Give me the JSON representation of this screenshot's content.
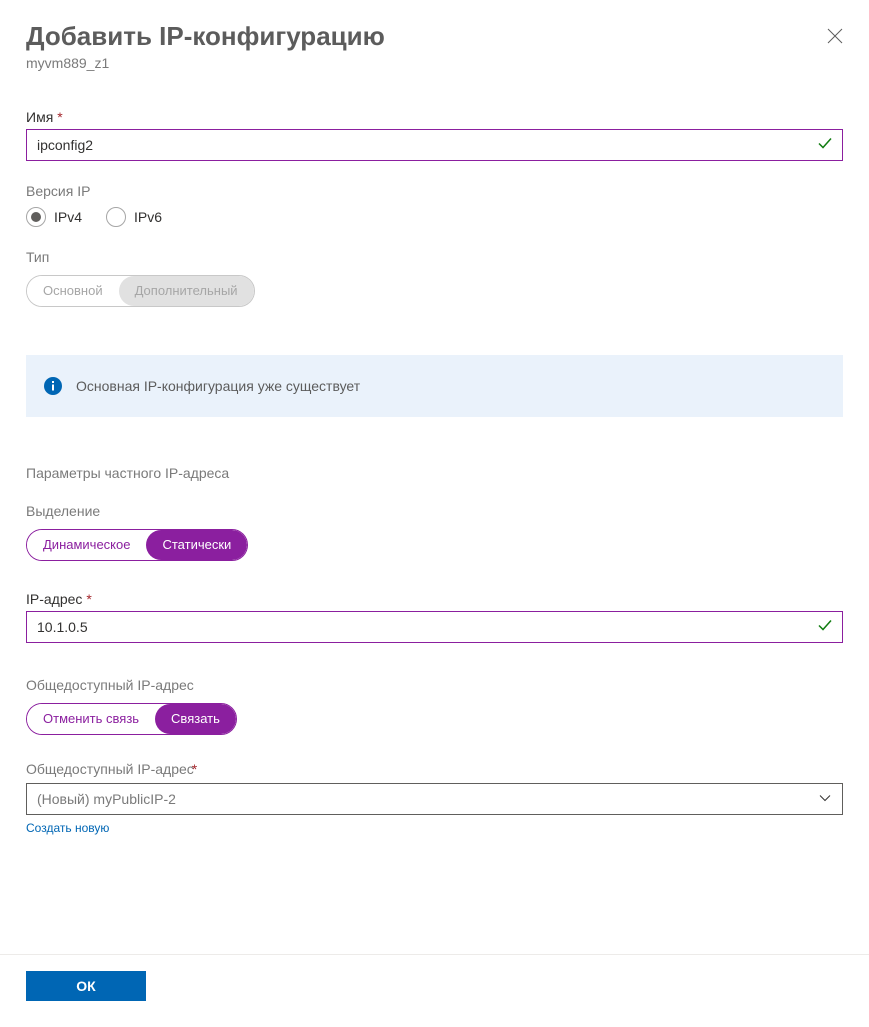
{
  "header": {
    "title": "Добавить IP-конфигурацию",
    "subtitle": "myvm889_z1"
  },
  "fields": {
    "name": {
      "label": "Имя",
      "value": "ipconfig2"
    },
    "ip_version": {
      "label": "Версия IP",
      "options": {
        "ipv4": "IPv4",
        "ipv6": "IPv6"
      },
      "selected": "ipv4"
    },
    "type": {
      "label": "Тип",
      "options": {
        "primary": "Основной",
        "secondary": "Дополнительный"
      }
    }
  },
  "info": {
    "text": "Основная IP-конфигурация уже существует"
  },
  "private_ip": {
    "heading": "Параметры частного IP-адреса",
    "allocation": {
      "label": "Выделение",
      "options": {
        "dynamic": "Динамическое",
        "static": "Статически"
      }
    },
    "address": {
      "label": "IP-адрес",
      "value": "10.1.0.5"
    }
  },
  "public_ip": {
    "association": {
      "label": "Общедоступный IP-адрес",
      "options": {
        "disassociate": "Отменить связь",
        "associate": "Связать"
      }
    },
    "address_select": {
      "label": "Общедоступный IP-адрес",
      "value": "(Новый) myPublicIP-2"
    },
    "create_link": "Создать новую"
  },
  "footer": {
    "ok": "ОК"
  }
}
